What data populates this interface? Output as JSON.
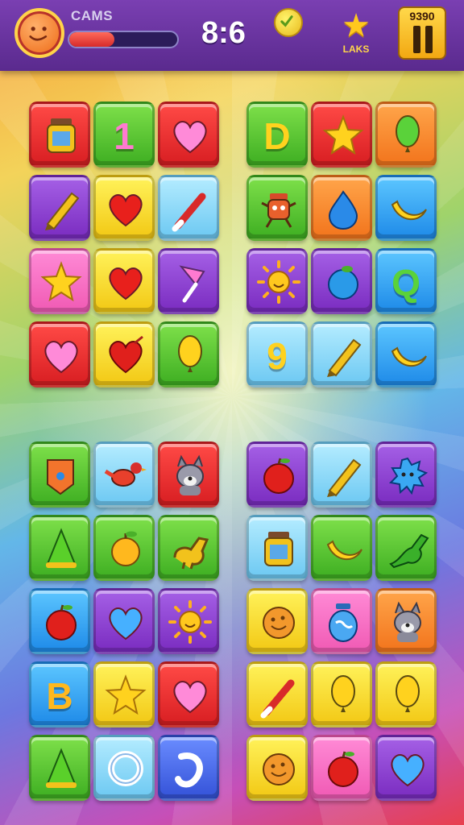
{
  "header": {
    "player_name": "CAMS",
    "progress": 0.42,
    "timer": "8:6",
    "star_label": "LAKS",
    "score": "9390"
  },
  "colors": {
    "bar": "#5a2a8e",
    "progress_fill": "#d62a2a",
    "button_gold": "#f2a812"
  },
  "boards": [
    {
      "name": "top-left",
      "tiles": [
        {
          "icon": "jar-icon",
          "color": "red"
        },
        {
          "icon": "number-one-icon",
          "color": "green",
          "text": "1"
        },
        {
          "icon": "heart-icon",
          "color": "red"
        },
        {
          "icon": "crayon-icon",
          "color": "purple"
        },
        {
          "icon": "heart-icon",
          "color": "yellow"
        },
        {
          "icon": "paintbrush-icon",
          "color": "sky"
        },
        {
          "icon": "star-icon",
          "color": "pink"
        },
        {
          "icon": "heart-icon",
          "color": "yellow"
        },
        {
          "icon": "cup-icon",
          "color": "purple"
        },
        {
          "icon": "heart-icon",
          "color": "red"
        },
        {
          "icon": "apple-heart-icon",
          "color": "yellow"
        },
        {
          "icon": "balloon-icon",
          "color": "green"
        }
      ]
    },
    {
      "name": "top-right",
      "tiles": [
        {
          "icon": "letter-d-icon",
          "color": "green",
          "text": "D"
        },
        {
          "icon": "star-icon",
          "color": "red"
        },
        {
          "icon": "balloon-icon",
          "color": "orange"
        },
        {
          "icon": "robot-icon",
          "color": "green"
        },
        {
          "icon": "water-drop-icon",
          "color": "orange"
        },
        {
          "icon": "banana-icon",
          "color": "blue"
        },
        {
          "icon": "sun-icon",
          "color": "purple"
        },
        {
          "icon": "blueberry-icon",
          "color": "purple"
        },
        {
          "icon": "letter-q-icon",
          "color": "blue",
          "text": "Q"
        },
        {
          "icon": "number-nine-icon",
          "color": "sky",
          "text": "9"
        },
        {
          "icon": "crayon-icon",
          "color": "sky"
        },
        {
          "icon": "banana-icon",
          "color": "blue"
        }
      ]
    },
    {
      "name": "bottom-left",
      "tiles": [
        {
          "icon": "tag-icon",
          "color": "green"
        },
        {
          "icon": "bird-icon",
          "color": "sky"
        },
        {
          "icon": "wolf-icon",
          "color": "red"
        },
        {
          "icon": "cone-icon",
          "color": "green"
        },
        {
          "icon": "orange-icon",
          "color": "green"
        },
        {
          "icon": "dinosaur-icon",
          "color": "green"
        },
        {
          "icon": "apple-icon",
          "color": "blue"
        },
        {
          "icon": "heart-icon",
          "color": "purple"
        },
        {
          "icon": "sun-icon",
          "color": "purple"
        },
        {
          "icon": "letter-b-icon",
          "color": "blue",
          "text": "B"
        },
        {
          "icon": "star-icon",
          "color": "yellow"
        },
        {
          "icon": "heart-icon",
          "color": "red"
        },
        {
          "icon": "cone-icon",
          "color": "green"
        },
        {
          "icon": "ring-icon",
          "color": "sky"
        },
        {
          "icon": "hook-icon",
          "color": "royal"
        }
      ]
    },
    {
      "name": "bottom-right",
      "tiles": [
        {
          "icon": "apple-icon",
          "color": "purple"
        },
        {
          "icon": "crayon-icon",
          "color": "sky"
        },
        {
          "icon": "blob-icon",
          "color": "purple"
        },
        {
          "icon": "jar-icon",
          "color": "sky"
        },
        {
          "icon": "banana-icon",
          "color": "green"
        },
        {
          "icon": "lizard-icon",
          "color": "green"
        },
        {
          "icon": "cookie-icon",
          "color": "yellow"
        },
        {
          "icon": "globe-jar-icon",
          "color": "pink"
        },
        {
          "icon": "wolf-icon",
          "color": "orange"
        },
        {
          "icon": "paintbrush-icon",
          "color": "yellow"
        },
        {
          "icon": "balloon-icon",
          "color": "yellow"
        },
        {
          "icon": "balloon-icon",
          "color": "yellow"
        },
        {
          "icon": "cookie-icon",
          "color": "yellow"
        },
        {
          "icon": "apple-icon",
          "color": "pink"
        },
        {
          "icon": "heart-icon",
          "color": "purple"
        }
      ]
    }
  ]
}
